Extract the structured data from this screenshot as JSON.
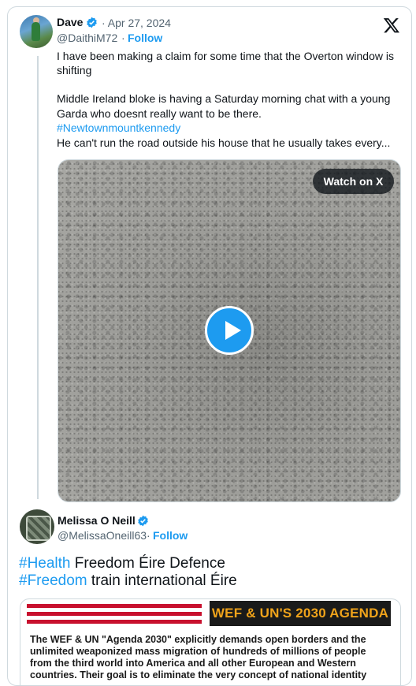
{
  "tweet1": {
    "name": "Dave",
    "date": "· Apr 27, 2024",
    "handle": "@DaithiM72",
    "dot": "·",
    "follow": "Follow",
    "lines": [
      "I have been making a claim for some time that the Overton window is",
      "shifting",
      "",
      "Middle Ireland bloke is having a Saturday morning chat with a young",
      "Garda who doesnt really want to be there."
    ],
    "hashtag": "#Newtownmountkennedy",
    "last_line": "He can't run the road outside his house that he usually takes every...",
    "video": {
      "watch_label": "Watch on X",
      "play_icon": "play-icon"
    }
  },
  "tweet2": {
    "name": "Melissa O Neill",
    "handle": "@MelissaOneill63",
    "dot": "·",
    "follow": "Follow",
    "line1_tag": "#Health",
    "line1_rest": " Freedom Éire Defence",
    "line2_tag": "#Freedom",
    "line2_rest": " train international Éire",
    "poster": {
      "banner": "WEF & UN'S 2030 AGENDA",
      "lines": [
        "The WEF & UN \"Agenda 2030\" explicitly demands open borders and the",
        "unlimited weaponized mass migration of hundreds of millions of people",
        "from the third world into America and all other European and Western",
        "countries. Their goal is to eliminate the very concept of national identity"
      ]
    }
  },
  "colors": {
    "accent": "#1d9bf0",
    "text": "#0f1419",
    "muted": "#536471",
    "border": "#cfd9de"
  }
}
